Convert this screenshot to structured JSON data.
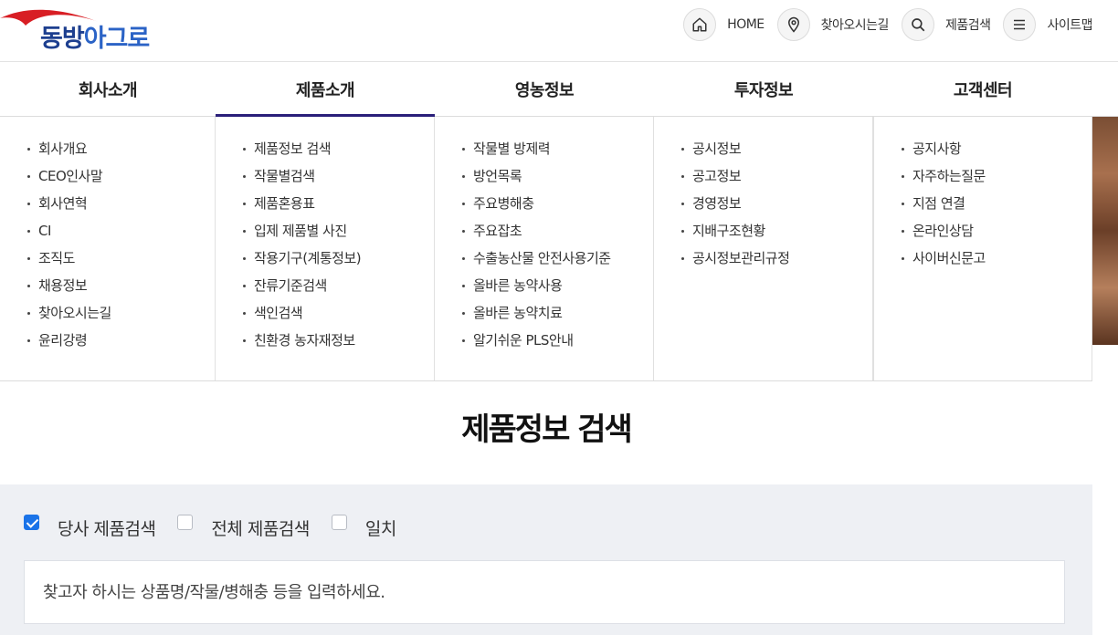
{
  "brand": {
    "logo_text_part1": "동방",
    "logo_text_part2": "아그로",
    "swoosh_color": "#d81e24",
    "primary_color": "#1d3f8f"
  },
  "util_nav": [
    {
      "label": "HOME",
      "icon": "home-icon"
    },
    {
      "label": "찾아오시는길",
      "icon": "location-pin-icon"
    },
    {
      "label": "제품검색",
      "icon": "search-icon"
    },
    {
      "label": "사이트맵",
      "icon": "menu-icon"
    }
  ],
  "gnb": [
    {
      "label": "회사소개",
      "active": false
    },
    {
      "label": "제품소개",
      "active": true
    },
    {
      "label": "영농정보",
      "active": false
    },
    {
      "label": "투자정보",
      "active": false
    },
    {
      "label": "고객센터",
      "active": false
    }
  ],
  "mega_menu": {
    "company": [
      "회사개요",
      "CEO인사말",
      "회사연혁",
      "CI",
      "조직도",
      "채용정보",
      "찾아오시는길",
      "윤리강령"
    ],
    "products": [
      "제품정보 검색",
      "작물별검색",
      "제품혼용표",
      "입제 제품별 사진",
      "작용기구(계통정보)",
      "잔류기준검색",
      "색인검색",
      "친환경 농자재정보"
    ],
    "farming": [
      "작물별 방제력",
      "방언목록",
      "주요병해충",
      "주요잡초",
      "수출농산물 안전사용기준",
      "올바른 농약사용",
      "올바른 농약치료",
      "알기쉬운 PLS안내"
    ],
    "investment": [
      "공시정보",
      "공고정보",
      "경영정보",
      "지배구조현황",
      "공시정보관리규정"
    ],
    "support": [
      "공지사항",
      "자주하는질문",
      "지점 연결",
      "온라인상담",
      "사이버신문고"
    ]
  },
  "page": {
    "title": "제품정보 검색"
  },
  "search": {
    "options": [
      {
        "label": "당사 제품검색",
        "checked": true
      },
      {
        "label": "전체 제품검색",
        "checked": false
      },
      {
        "label": "일치",
        "checked": false
      }
    ],
    "placeholder": "찾고자 하시는 상품명/작물/병해충 등을 입력하세요.",
    "value": ""
  },
  "colors": {
    "gnb_active_bar": "#2a1f7a",
    "checkbox_checked": "#1a73e8",
    "search_panel_bg": "#eef0f4"
  }
}
